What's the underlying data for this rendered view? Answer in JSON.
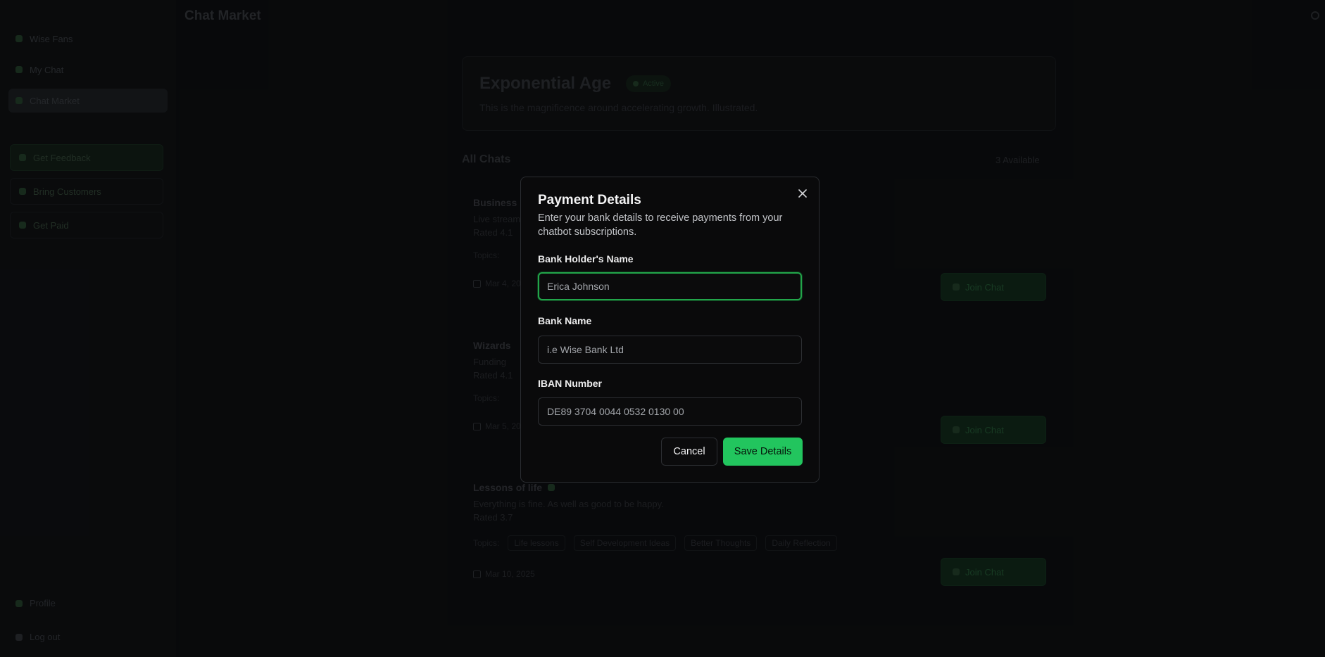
{
  "app": {
    "page_title": "Chat Market",
    "sidebar": {
      "nav": [
        "Wise Fans",
        "My Chat",
        "Chat Market"
      ],
      "cards": [
        "Get Feedback",
        "Bring Customers",
        "Get Paid"
      ],
      "bottom": [
        "Profile",
        "Log out"
      ]
    },
    "hero": {
      "title": "Exponential Age",
      "badge": "Active",
      "description": "This is the magnificence around accelerating growth. Illustrated."
    },
    "list": {
      "title": "All Chats",
      "count": "3 Available"
    },
    "chats": [
      {
        "name": "Business",
        "desc": "Live stream",
        "meta": "Rated 4.1",
        "tags_label": "Topics:",
        "tags": [],
        "date": "Mar 4, 2025",
        "button": "Join Chat"
      },
      {
        "name": "Wizards",
        "desc": "Funding",
        "meta": "Rated 4.1",
        "tags_label": "Topics:",
        "tags": [],
        "date": "Mar 5, 2025",
        "button": "Join Chat"
      },
      {
        "name": "Lessons of life",
        "desc": "Everything is fine. As well as good to be happy.",
        "meta": "Rated 3.7",
        "tags_label": "Topics:",
        "tags": [
          "Life lessons",
          "Self Development Ideas",
          "Better Thoughts",
          "Daily Reflection"
        ],
        "date": "Mar 10, 2025",
        "button": "Join Chat"
      }
    ]
  },
  "modal": {
    "title": "Payment Details",
    "description": "Enter your bank details to receive payments from your chatbot subscriptions.",
    "fields": {
      "holder": {
        "label": "Bank Holder's Name",
        "placeholder": "Erica Johnson",
        "value": ""
      },
      "bank": {
        "label": "Bank Name",
        "placeholder": "i.e Wise Bank Ltd",
        "value": ""
      },
      "iban": {
        "label": "IBAN Number",
        "placeholder": "DE89 3704 0044 0532 0130 00",
        "value": ""
      }
    },
    "cancel_label": "Cancel",
    "save_label": "Save Details"
  },
  "colors": {
    "accent": "#22c55e",
    "focus_ring": "#22a54a",
    "background": "#0b0c0e",
    "modal_border": "#2b2d31"
  },
  "icons": [
    "close-icon",
    "calendar-icon",
    "status-dot-icon"
  ]
}
